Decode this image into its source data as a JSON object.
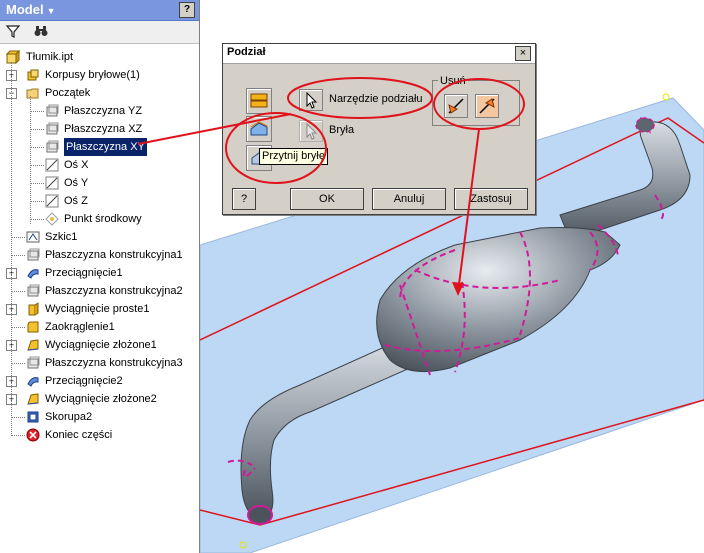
{
  "panel": {
    "title": "Model",
    "help": "?"
  },
  "toolbar": {
    "filter_icon": "filter-icon",
    "find_icon": "binoculars-icon"
  },
  "tree": {
    "root": "Tłumik.ipt",
    "items": [
      {
        "label": "Korpusy bryłowe(1)",
        "icon": "solid-bodies-icon"
      },
      {
        "label": "Początek",
        "icon": "folder-icon"
      },
      {
        "label": "Płaszczyzna YZ",
        "icon": "plane-icon"
      },
      {
        "label": "Płaszczyzna XZ",
        "icon": "plane-icon"
      },
      {
        "label": "Płaszczyzna XY",
        "icon": "plane-icon"
      },
      {
        "label": "Oś X",
        "icon": "axis-icon"
      },
      {
        "label": "Oś Y",
        "icon": "axis-icon"
      },
      {
        "label": "Oś Z",
        "icon": "axis-icon"
      },
      {
        "label": "Punkt środkowy",
        "icon": "point-icon"
      },
      {
        "label": "Szkic1",
        "icon": "sketch-icon"
      },
      {
        "label": "Płaszczyzna konstrukcyjna1",
        "icon": "plane-icon"
      },
      {
        "label": "Przeciągnięcie1",
        "icon": "sweep-icon"
      },
      {
        "label": "Płaszczyzna konstrukcyjna2",
        "icon": "plane-icon"
      },
      {
        "label": "Wyciągnięcie proste1",
        "icon": "extrude-icon"
      },
      {
        "label": "Zaokrąglenie1",
        "icon": "fillet-icon"
      },
      {
        "label": "Wyciągnięcie złożone1",
        "icon": "loft-icon"
      },
      {
        "label": "Płaszczyzna konstrukcyjna3",
        "icon": "plane-icon"
      },
      {
        "label": "Przeciągnięcie2",
        "icon": "sweep-icon"
      },
      {
        "label": "Wyciągnięcie złożone2",
        "icon": "loft-icon"
      },
      {
        "label": "Skorupa2",
        "icon": "shell-icon"
      },
      {
        "label": "Koniec części",
        "icon": "end-of-part-icon"
      }
    ]
  },
  "dialog": {
    "title": "Podział",
    "close": "×",
    "tool_label": "Narzędzie podziału",
    "body_label": "Bryła",
    "remove_group": "Usuń",
    "tooltip": "Przytnij bryłę",
    "help": "?",
    "ok": "OK",
    "cancel": "Anuluj",
    "apply": "Zastosuj"
  },
  "colors": {
    "header": "#7a96df",
    "dialog_bg": "#d4d0c8",
    "annotation": "#e0121b",
    "split_line": "#d01a9a",
    "plane_fill": "#bcd8f4",
    "selection": "#0a246a"
  }
}
